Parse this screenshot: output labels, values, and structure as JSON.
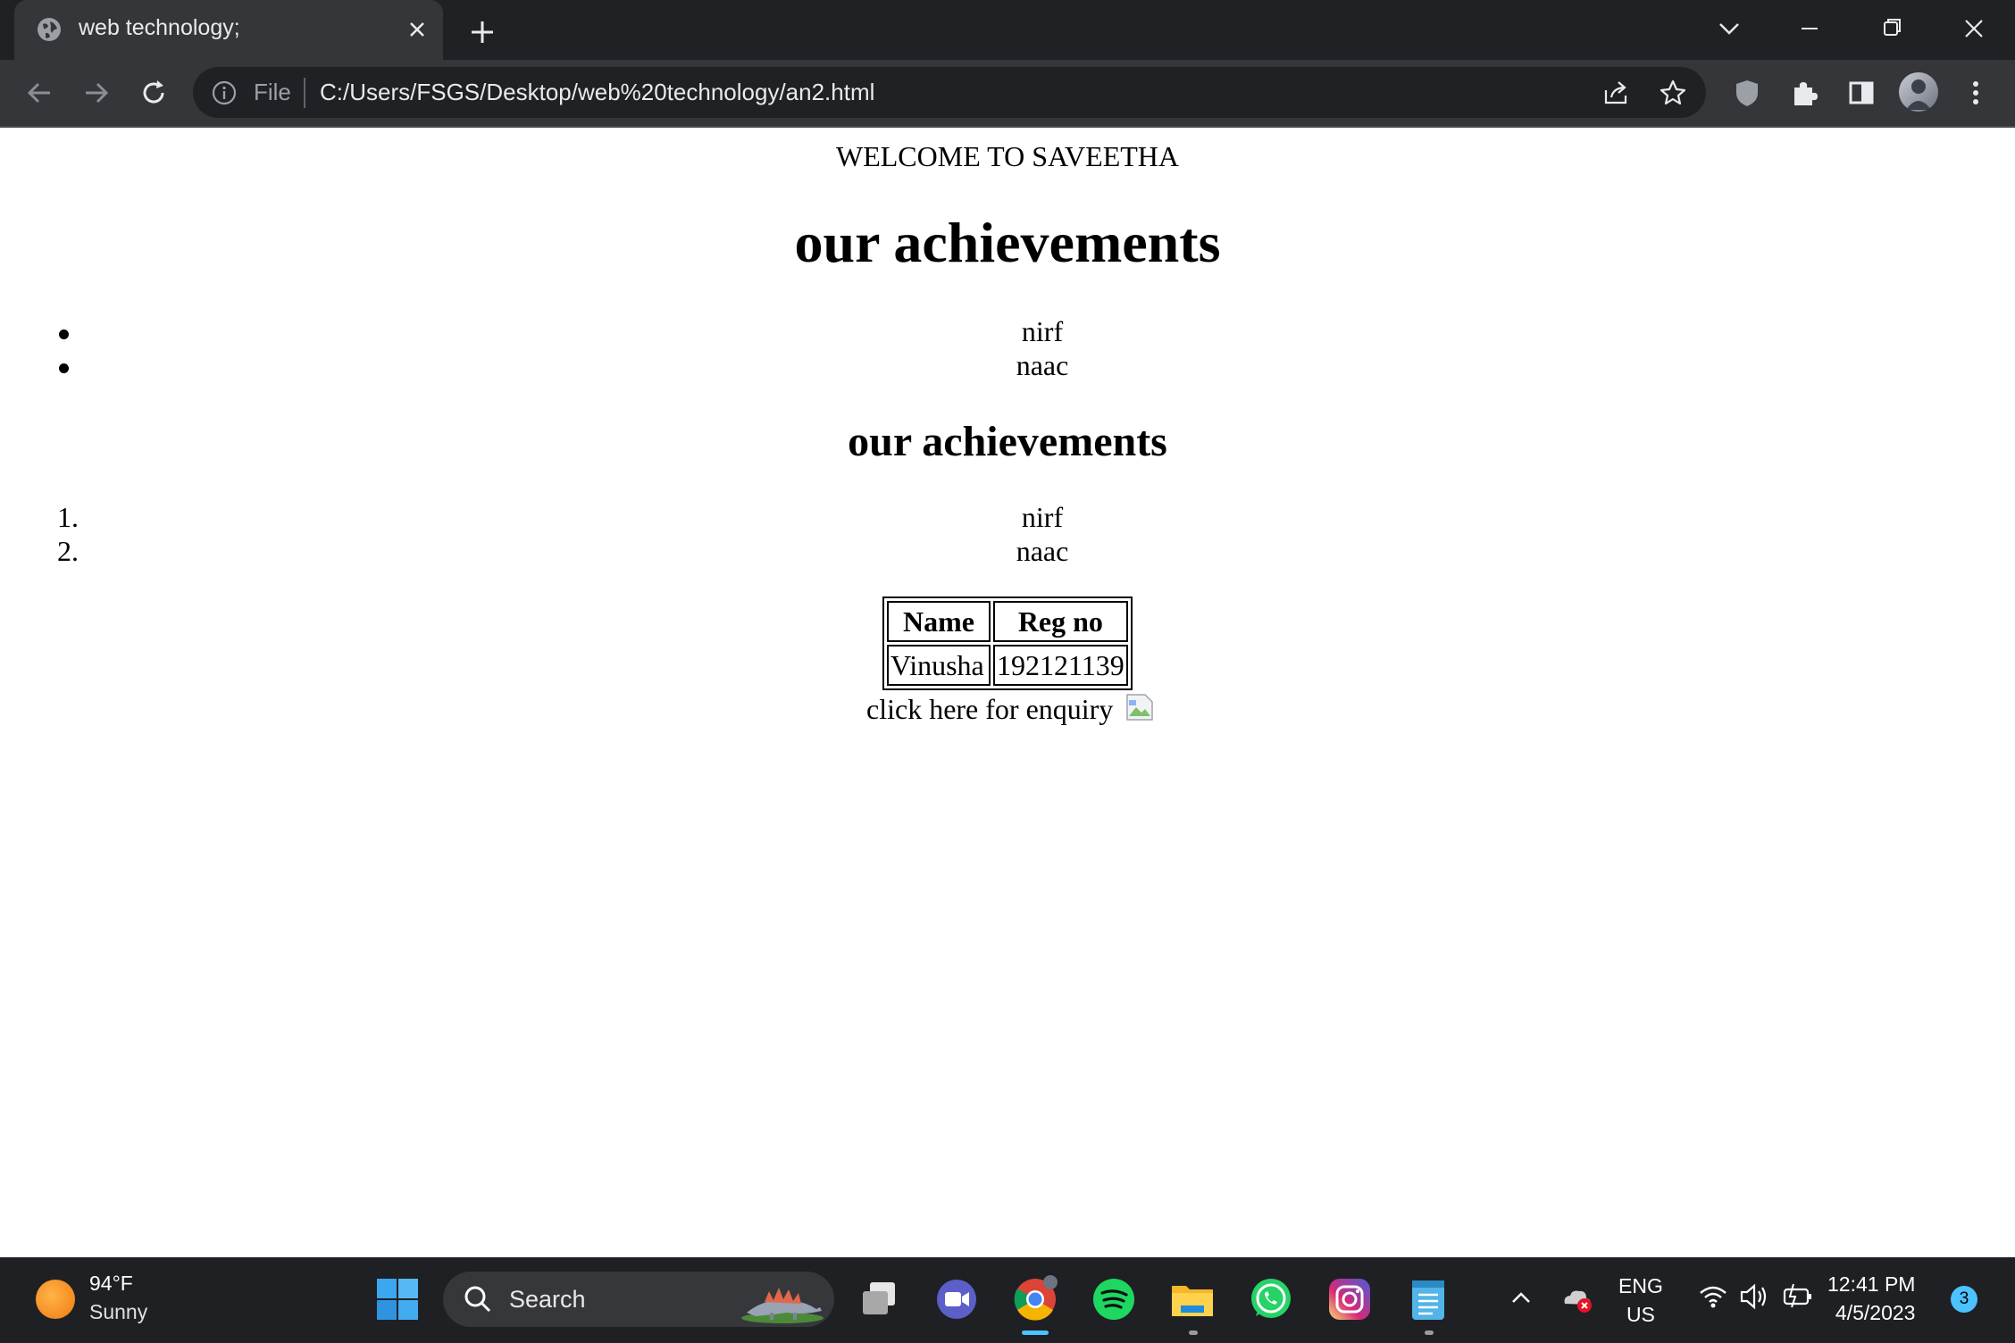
{
  "browser": {
    "tab_title": "web technology;",
    "url_scheme_label": "File",
    "url": "C:/Users/FSGS/Desktop/web%20technology/an2.html"
  },
  "page": {
    "welcome": "WELCOME TO SAVEETHA",
    "heading1": "our achievements",
    "unordered_list": [
      "nirf",
      "naac"
    ],
    "heading2": "our achievements",
    "ordered_list": [
      {
        "marker": "1.",
        "text": "nirf"
      },
      {
        "marker": "2.",
        "text": "naac"
      }
    ],
    "table": {
      "headers": [
        "Name",
        "Reg no"
      ],
      "rows": [
        [
          "Vinusha",
          "192121139"
        ]
      ]
    },
    "enquiry_text": "click here for enquiry"
  },
  "taskbar": {
    "weather_temp": "94°F",
    "weather_condition": "Sunny",
    "search_label": "Search",
    "lang_line1": "ENG",
    "lang_line2": "US",
    "time": "12:41 PM",
    "date": "4/5/2023",
    "notification_count": "3",
    "apps": [
      "windows-start",
      "task-view",
      "teams-meet",
      "chrome",
      "spotify",
      "file-explorer",
      "whatsapp",
      "instagram",
      "notepad"
    ]
  },
  "colors": {
    "tabstrip": "#202124",
    "toolbar": "#35363a",
    "taskbar": "#1f2024",
    "accent": "#4cc2ff"
  }
}
